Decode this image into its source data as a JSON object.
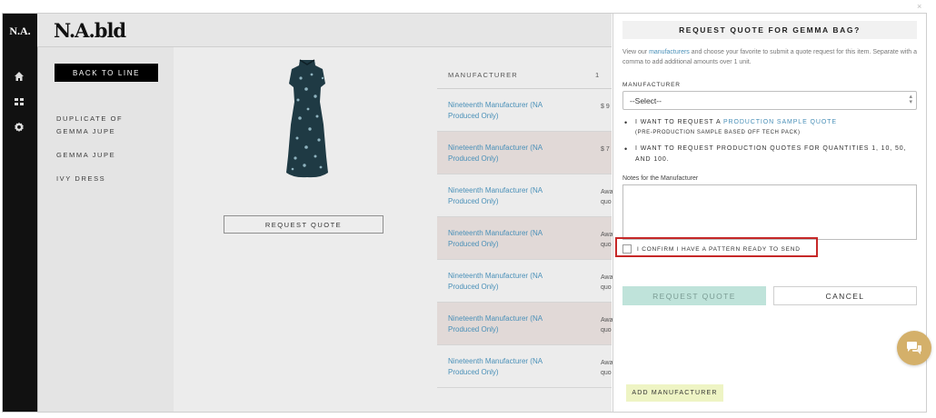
{
  "app": {
    "logo_mark": "N.A.",
    "brand": "N.A.bld"
  },
  "nav_icons": [
    "home-icon",
    "grid-icon",
    "gear-icon"
  ],
  "sidebar": {
    "back_label": "BACK TO LINE",
    "items": [
      {
        "label": "DUPLICATE OF GEMMA JUPE"
      },
      {
        "label": "GEMMA JUPE"
      },
      {
        "label": "IVY DRESS"
      }
    ]
  },
  "product": {
    "request_quote_label": "REQUEST QUOTE"
  },
  "manufacturers_table": {
    "header": "MANUFACTURER",
    "header_col2": "1",
    "rows": [
      {
        "name": "Nineteenth Manufacturer (NA Produced Only)",
        "price": "$ 9"
      },
      {
        "name": "Nineteenth Manufacturer (NA Produced Only)",
        "price": "$ 7"
      },
      {
        "name": "Nineteenth Manufacturer (NA Produced Only)",
        "price": "Awa quo"
      },
      {
        "name": "Nineteenth Manufacturer (NA Produced Only)",
        "price": "Awa quo"
      },
      {
        "name": "Nineteenth Manufacturer (NA Produced Only)",
        "price": "Awa quo"
      },
      {
        "name": "Nineteenth Manufacturer (NA Produced Only)",
        "price": "Awa quo"
      },
      {
        "name": "Nineteenth Manufacturer (NA Produced Only)",
        "price": "Awa quo"
      }
    ]
  },
  "modal": {
    "close_glyph": "×",
    "title": "REQUEST QUOTE FOR GEMMA BAG?",
    "intro_before": "View our ",
    "intro_link": "manufacturers",
    "intro_after": " and choose your favorite to submit a quote request for this item. Separate with a comma to add additional amounts over 1 unit.",
    "manufacturer_label": "MANUFACTURER",
    "select_value": "--Select--",
    "option1_before": "I WANT TO REQUEST A ",
    "option1_link": "PRODUCTION SAMPLE QUOTE",
    "option1_sub": "(PRE-PRODUCTION SAMPLE BASED OFF TECH PACK)",
    "option2": "I WANT TO REQUEST PRODUCTION QUOTES FOR QUANTITIES 1, 10, 50, AND 100.",
    "notes_label": "Notes for the Manufacturer",
    "notes_value": "",
    "confirm_label": "I CONFIRM I HAVE A PATTERN READY TO SEND",
    "confirm_checked": false,
    "submit_label": "REQUEST QUOTE",
    "cancel_label": "CANCEL",
    "add_manufacturer_label": "ADD MANUFACTURER"
  },
  "colors": {
    "accent_link": "#4a90b8",
    "primary_button": "#bfe3da",
    "highlight_red": "#c62828",
    "chat": "#d4b06a",
    "add_button": "#eef4c4"
  }
}
